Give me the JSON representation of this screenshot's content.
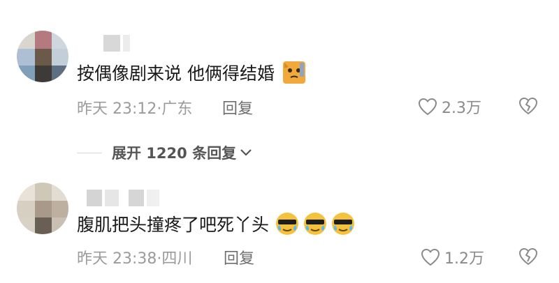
{
  "comments": [
    {
      "text": "按偶像剧来说 他俩得结婚",
      "emoji": [
        "cat-sweat"
      ],
      "time": "昨天 23:12·广东",
      "reply_label": "回复",
      "likes": "2.3万",
      "expand_label": "展开 1220 条回复"
    },
    {
      "text": "腹肌把头撞疼了吧死丫头",
      "emoji": [
        "cool-sweat",
        "cool-sweat",
        "cool-sweat"
      ],
      "time": "昨天 23:38·四川",
      "reply_label": "回复",
      "likes": "1.2万"
    }
  ],
  "colors": {
    "text": "#1a1a1a",
    "meta": "#9b9b9b",
    "icon": "#8a8a8a"
  }
}
